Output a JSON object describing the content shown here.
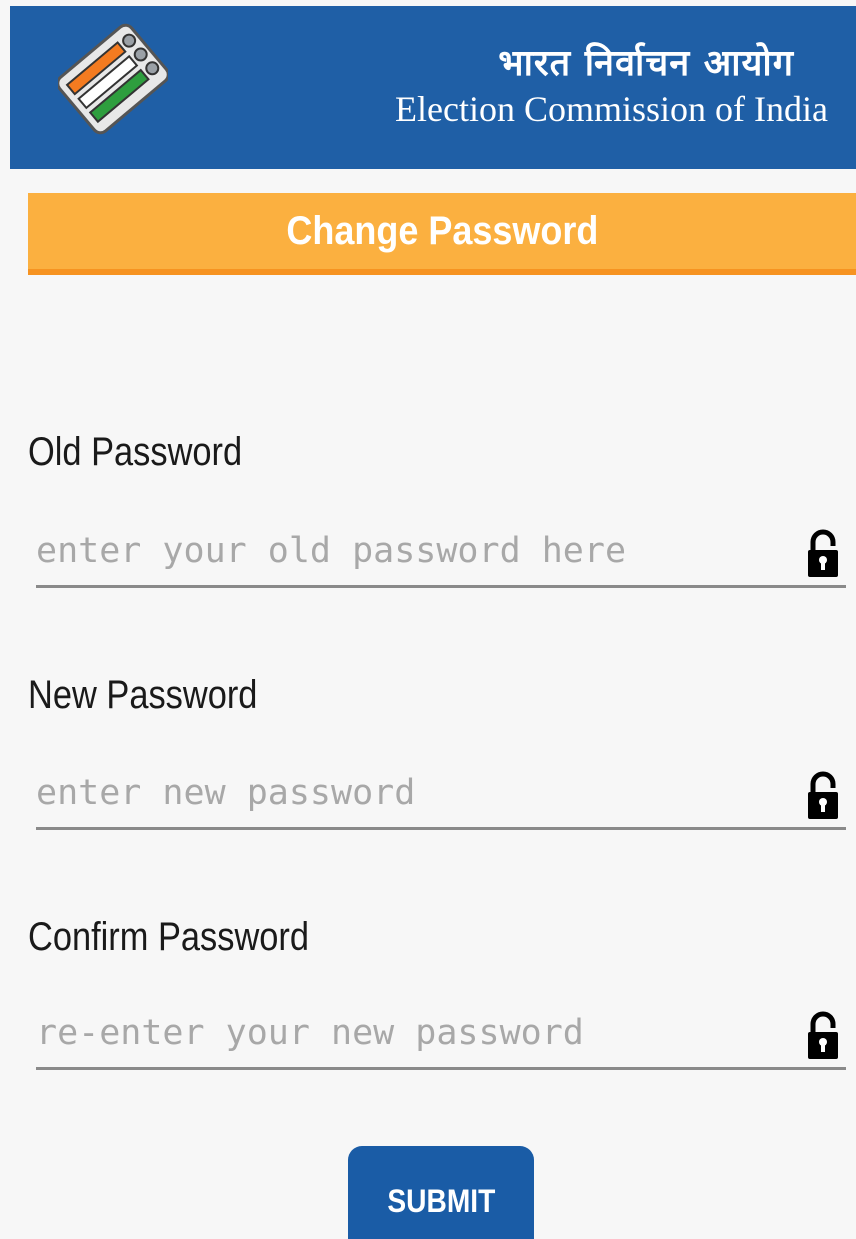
{
  "header": {
    "org_name_hindi": "भारत निर्वाचन आयोग",
    "org_name_english": "Election Commission of India",
    "logo_icon": "ballot-box-logo-icon",
    "background_color": "#1f5fa6"
  },
  "page": {
    "title": "Change Password",
    "title_bar_color": "#fbb040"
  },
  "form": {
    "old_password": {
      "label": "Old Password",
      "placeholder": "enter your old password here",
      "value": "",
      "icon": "lock-icon"
    },
    "new_password": {
      "label": "New Password",
      "placeholder": "enter new password",
      "value": "",
      "icon": "lock-icon"
    },
    "confirm_password": {
      "label": "Confirm Password",
      "placeholder": "re-enter your new password",
      "value": "",
      "icon": "lock-icon"
    },
    "submit_label": "SUBMIT",
    "submit_color": "#1a5ca6"
  }
}
